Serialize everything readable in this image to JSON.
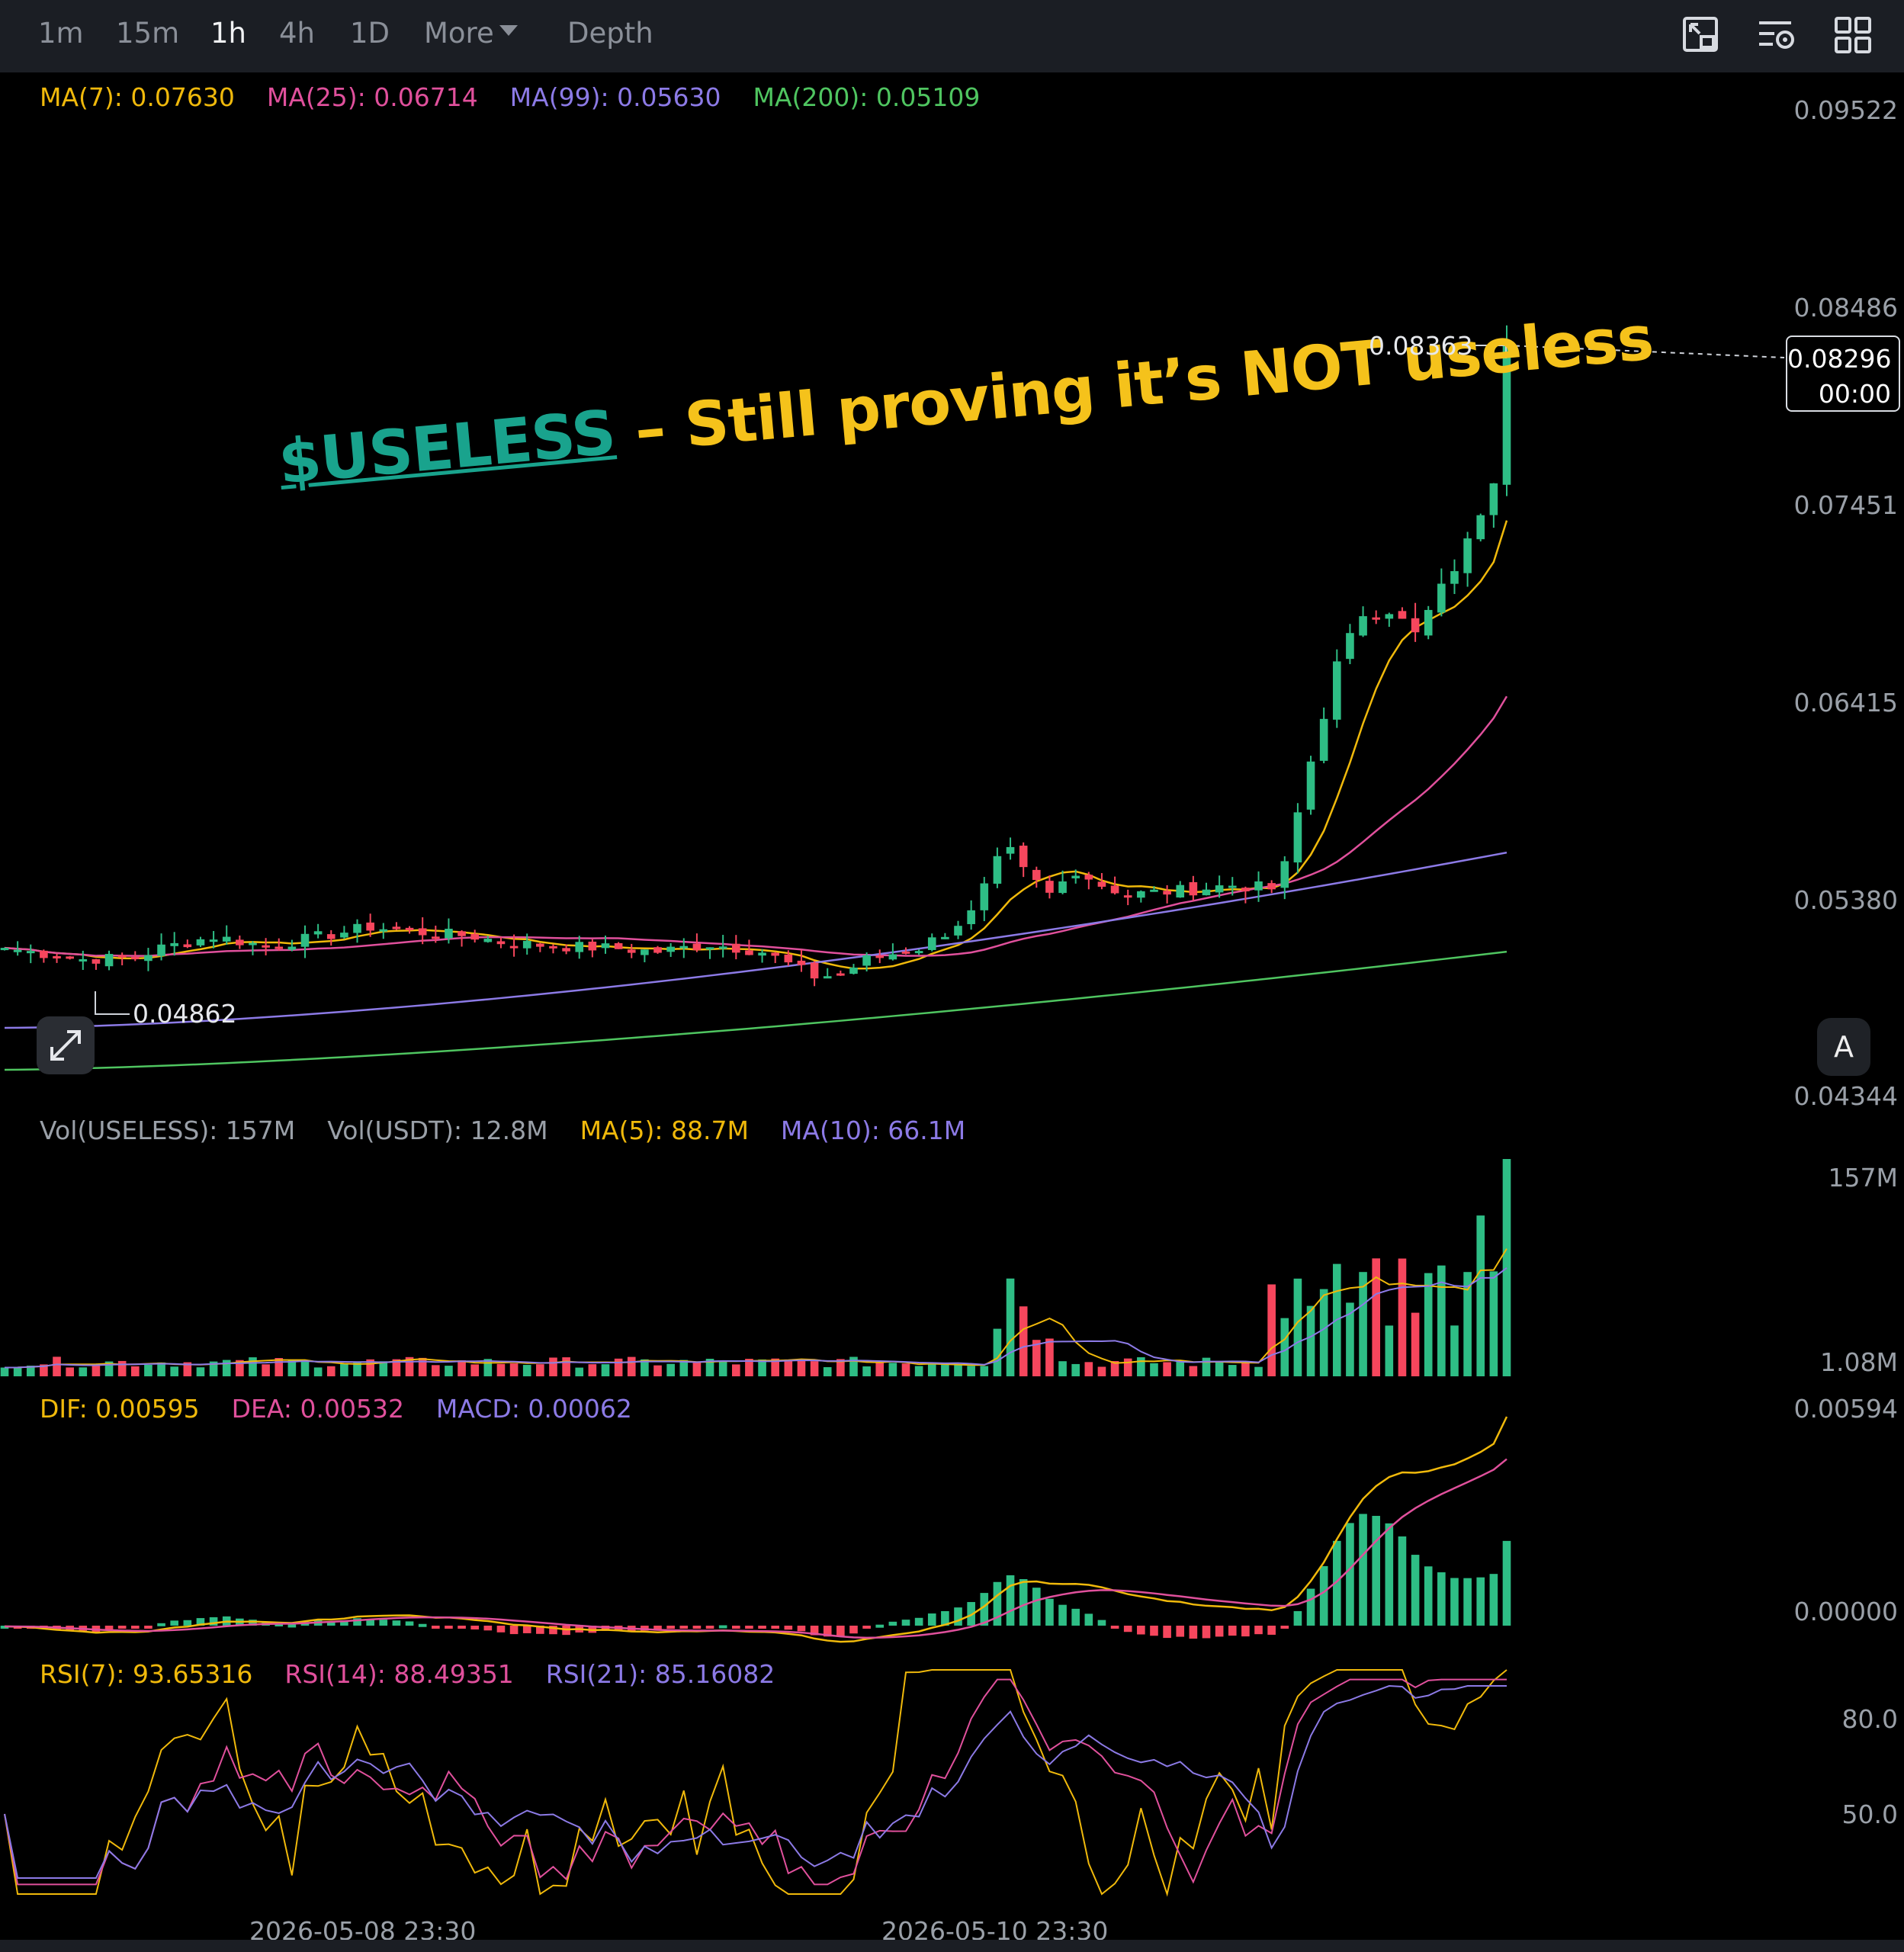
{
  "timeframes": [
    {
      "label": "1m",
      "active": false
    },
    {
      "label": "15m",
      "active": false
    },
    {
      "label": "1h",
      "active": true
    },
    {
      "label": "4h",
      "active": false
    },
    {
      "label": "1D",
      "active": false
    },
    {
      "label": "More",
      "active": false
    },
    {
      "label": "Depth",
      "active": false
    }
  ],
  "toolbar_icons": [
    "fullscreen-chart-icon",
    "indicator-settings-icon",
    "grid-layout-icon"
  ],
  "legend_price": {
    "ma7": "MA(7): 0.07630",
    "ma25": "MA(25): 0.06714",
    "ma99": "MA(99): 0.05630",
    "ma200": "MA(200): 0.05109"
  },
  "legend_vol": {
    "vol_base": "Vol(USELESS): 157M",
    "vol_quote": "Vol(USDT): 12.8M",
    "ma5": "MA(5): 88.7M",
    "ma10": "MA(10): 66.1M"
  },
  "legend_macd": {
    "dif": "DIF: 0.00595",
    "dea": "DEA: 0.00532",
    "macd": "MACD: 0.00062"
  },
  "legend_rsi": {
    "rsi7": "RSI(7): 93.65316",
    "rsi14": "RSI(14): 88.49351",
    "rsi21": "RSI(21): 85.16082"
  },
  "price_axis": [
    "0.09522",
    "0.08486",
    "0.07451",
    "0.06415",
    "0.05380",
    "0.04344"
  ],
  "vol_axis": [
    "157M",
    "1.08M"
  ],
  "macd_axis": [
    "0.00594",
    "0.00000"
  ],
  "rsi_axis": [
    "80.0",
    "50.0"
  ],
  "current_price": {
    "price": "0.08296",
    "countdown": "00:00"
  },
  "high_marker": "0.08363",
  "low_marker": "0.04862",
  "date_labels": [
    "2026-05-08 23:30",
    "2026-05-10 23:30"
  ],
  "auto_button": "A",
  "headline": {
    "ticker": "$USELESS",
    "text": " – Still proving it’s NOT useless"
  },
  "colors": {
    "up": "#2ebd85",
    "down": "#f6465d",
    "ma7": "#f0b90b",
    "ma25": "#e0509c",
    "ma99": "#8c7ae6",
    "ma200": "#4fc560",
    "text_muted": "#8a8f98",
    "toolbar_bg": "#1b1e24"
  },
  "chart_data": {
    "type": "candlestick",
    "interval": "1h",
    "x_labels": [
      "2026-05-08 23:30",
      "2026-05-10 23:30"
    ],
    "y_range": [
      0.04344,
      0.09522
    ],
    "candle_count": 116,
    "key_prices": {
      "period_low": 0.04862,
      "period_high": 0.08363,
      "last": 0.08296
    },
    "close_path": [
      [
        0,
        0.0512
      ],
      [
        6,
        0.0506
      ],
      [
        10,
        0.0507
      ],
      [
        12,
        0.0512
      ],
      [
        16,
        0.0518
      ],
      [
        20,
        0.0513
      ],
      [
        25,
        0.0519
      ],
      [
        28,
        0.0523
      ],
      [
        32,
        0.052
      ],
      [
        36,
        0.0518
      ],
      [
        38,
        0.0515
      ],
      [
        42,
        0.0513
      ],
      [
        46,
        0.0512
      ],
      [
        50,
        0.051
      ],
      [
        54,
        0.0514
      ],
      [
        58,
        0.051
      ],
      [
        62,
        0.0497
      ],
      [
        64,
        0.0498
      ],
      [
        66,
        0.0506
      ],
      [
        70,
        0.0512
      ],
      [
        72,
        0.052
      ],
      [
        74,
        0.053
      ],
      [
        76,
        0.0557
      ],
      [
        77,
        0.0562
      ],
      [
        78,
        0.0552
      ],
      [
        80,
        0.054
      ],
      [
        82,
        0.0553
      ],
      [
        84,
        0.0545
      ],
      [
        86,
        0.054
      ],
      [
        90,
        0.0542
      ],
      [
        94,
        0.0545
      ],
      [
        97,
        0.0543
      ],
      [
        98,
        0.0555
      ],
      [
        100,
        0.061
      ],
      [
        102,
        0.066
      ],
      [
        104,
        0.0688
      ],
      [
        106,
        0.069
      ],
      [
        108,
        0.0676
      ],
      [
        110,
        0.07
      ],
      [
        112,
        0.0724
      ],
      [
        114,
        0.076
      ],
      [
        115,
        0.083
      ]
    ],
    "volume_range": [
      "1.08M",
      "157M"
    ],
    "volume_last": "157M",
    "macd_range": [
      0.0,
      0.00594
    ],
    "rsi_levels": [
      50.0,
      80.0
    ]
  }
}
